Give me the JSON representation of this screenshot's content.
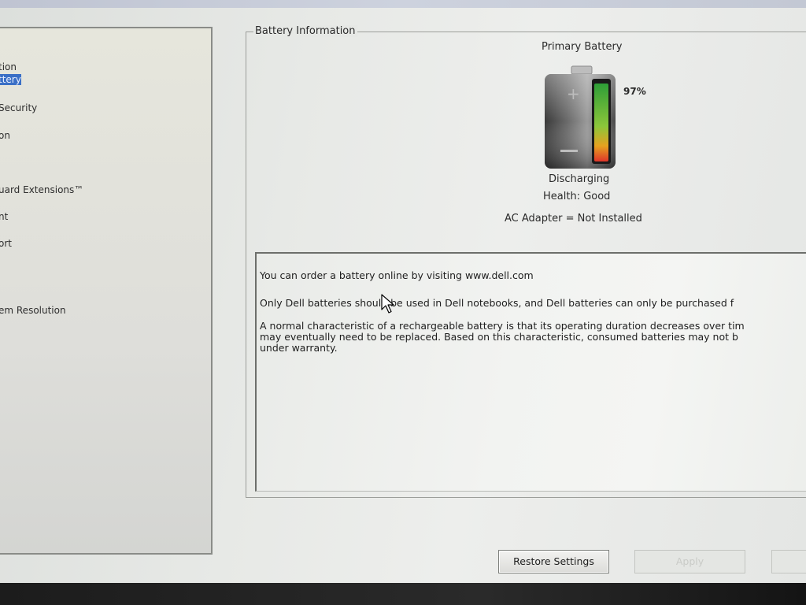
{
  "nav": {
    "items": [
      {
        "label": "tion",
        "top": 0
      },
      {
        "label": "ttery",
        "selected": true
      },
      {
        "label": "Security"
      },
      {
        "label": "on"
      },
      {
        "label": "uard Extensions™"
      },
      {
        "label": "nt"
      },
      {
        "label": "ort"
      },
      {
        "label": "em Resolution"
      }
    ]
  },
  "battery_info": {
    "group_title": "Battery Information",
    "battery_title": "Primary Battery",
    "charge_percent": "97%",
    "charge_level": 0.97,
    "status": "Discharging",
    "health": "Health: Good",
    "adapter": "AC Adapter = Not Installed"
  },
  "info_panel": {
    "line1": "You can order a battery online by visiting www.dell.com",
    "line2": "Only Dell batteries should be used in Dell notebooks, and Dell batteries can only be purchased f",
    "line3a": "A normal characteristic of a rechargeable battery is that its operating duration decreases over tim",
    "line3b": "may eventually need to be replaced.  Based on this characteristic, consumed batteries may not b",
    "line3c": "under warranty."
  },
  "buttons": {
    "restore": "Restore Settings",
    "apply": "Apply"
  },
  "colors": {
    "selection": "#3a6fc6",
    "battery_green": "#3cae3a",
    "battery_red": "#e0352a"
  },
  "icons": {
    "battery": "battery-icon",
    "cursor": "mouse-pointer-icon"
  }
}
